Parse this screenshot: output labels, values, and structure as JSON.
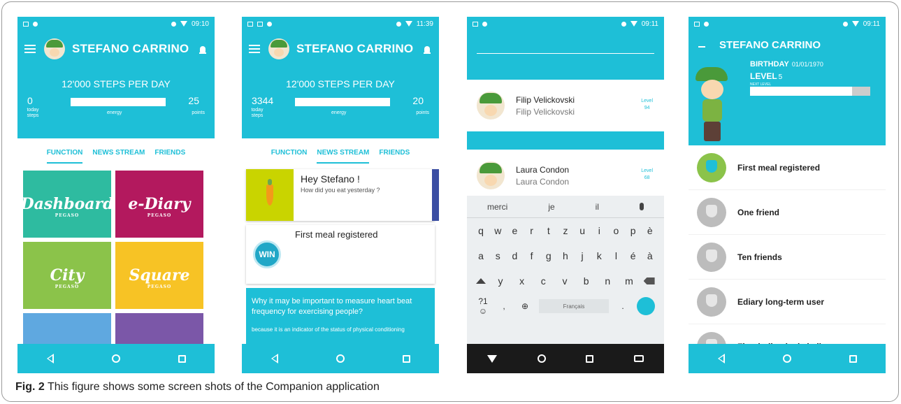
{
  "caption": {
    "label": "Fig. 2",
    "text": "This figure shows some screen shots of the Companion application"
  },
  "status": {
    "time1": "09:10",
    "time2": "11:39",
    "time3": "09:11",
    "time4": "09:11"
  },
  "user": {
    "name": "STEFANO CARRINO"
  },
  "goal": "12'000 STEPS PER DAY",
  "phone1": {
    "steps": "0",
    "points": "25"
  },
  "phone2": {
    "steps": "3344",
    "points": "20"
  },
  "stat_labels": {
    "today_steps": "today steps",
    "energy": "energy",
    "points": "points"
  },
  "tabs": {
    "function": "FUNCTION",
    "news": "NEWS STREAM",
    "friends": "FRIENDS"
  },
  "tiles": {
    "dashboard": "Dashboard",
    "ediary": "e-Diary",
    "city": "City",
    "square": "Square",
    "brand": "PEGASO"
  },
  "news": {
    "greeting": "Hey Stefano !",
    "question": "How did you eat yesterday ?",
    "meal": "First meal registered",
    "win": "WIN",
    "quiz_q": "Why it may be important to measure heart beat frequency for exercising people?",
    "quiz_a": "because it is an indicator of the status of physical conditioning"
  },
  "friends": [
    {
      "name": "Filip Velickovski",
      "sub": "Filip Velickovski",
      "level_label": "Level",
      "level": "94"
    },
    {
      "name": "Laura Condon",
      "sub": "Laura Condon",
      "level_label": "Level",
      "level": "68"
    }
  ],
  "keyboard": {
    "suggestions": [
      "merci",
      "je",
      "il"
    ],
    "row1": [
      "q",
      "w",
      "e",
      "r",
      "t",
      "z",
      "u",
      "i",
      "o",
      "p",
      "è"
    ],
    "row2": [
      "a",
      "s",
      "d",
      "f",
      "g",
      "h",
      "j",
      "k",
      "l",
      "é",
      "à"
    ],
    "row3": [
      "y",
      "x",
      "c",
      "v",
      "b",
      "n",
      "m"
    ],
    "sym": "?1☺",
    "comma": ",",
    "space": "Français"
  },
  "profile": {
    "birthday_label": "BIRTHDAY",
    "birthday": "01/01/1970",
    "level_label": "LEVEL",
    "level": "5",
    "next_level": "NEXT LEVEL",
    "progress_fraction": 0.85
  },
  "achievements": [
    "First meal registered",
    "One friend",
    "Ten friends",
    "Ediary long-term user",
    "First indivudual challenge won"
  ]
}
